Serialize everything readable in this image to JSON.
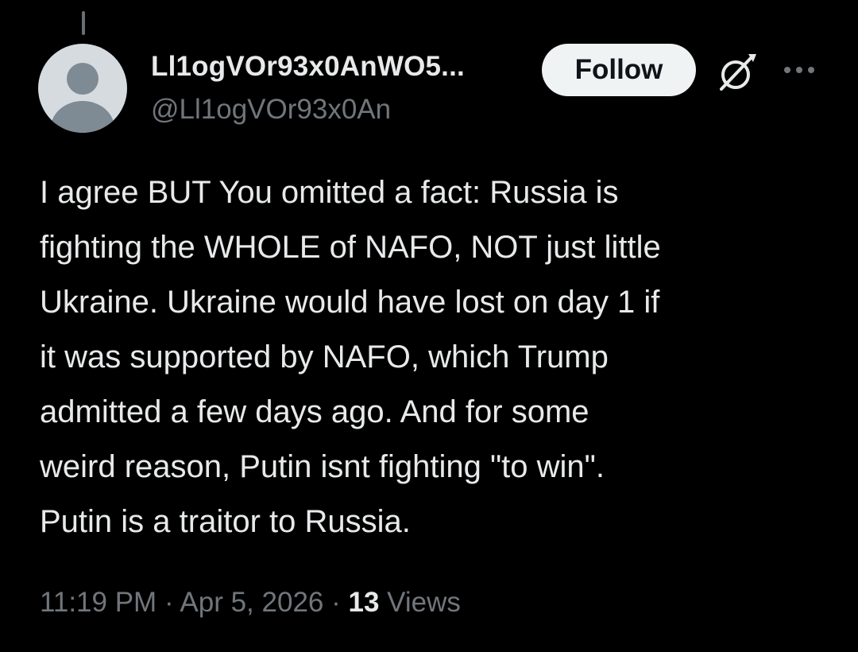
{
  "tweet": {
    "author": {
      "display_name": "Ll1ogVOr93x0AnWO5...",
      "handle": "@Ll1ogVOr93x0An",
      "avatar_icon": "default-avatar-icon"
    },
    "follow_label": "Follow",
    "icons": {
      "grok": "grok-icon",
      "more": "more-options-icon"
    },
    "text": "I agree BUT You omitted a fact: Russia is\nfighting the WHOLE of NAFO, NOT just little\nUkraine. Ukraine would have lost on day 1 if\nit was supported by NAFO, which Trump\nadmitted a few days ago. And for some\nweird reason, Putin isnt fighting \"to win\".\nPutin is a traitor to Russia.",
    "time": "11:19 PM",
    "separator": "·",
    "date": "Apr 5, 2026",
    "views_count": "13",
    "views_label": "Views"
  },
  "colors": {
    "background": "#000000",
    "primary_text": "#e7e9ea",
    "secondary_text": "#71767b",
    "follow_bg": "#eff3f4",
    "follow_text": "#0f1419",
    "avatar_bg": "#d6dbe0",
    "avatar_fg": "#7e8a94"
  }
}
